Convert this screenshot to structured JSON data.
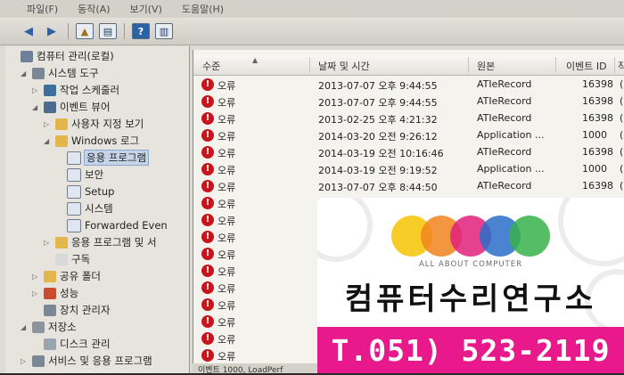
{
  "menu": [
    "파일(F)",
    "동작(A)",
    "보기(V)",
    "도움말(H)"
  ],
  "tree": {
    "items": [
      {
        "label": "컴퓨터 관리(로컬)",
        "icon": "computer-management-icon",
        "level": 0,
        "arrow": ""
      },
      {
        "label": "시스템 도구",
        "icon": "tools-icon",
        "level": 1,
        "arrow": "◢"
      },
      {
        "label": "작업 스케줄러",
        "icon": "clock-icon",
        "level": 2,
        "arrow": "▷"
      },
      {
        "label": "이벤트 뷰어",
        "icon": "event-viewer-icon",
        "level": 2,
        "arrow": "◢"
      },
      {
        "label": "사용자 지정 보기",
        "icon": "folder-icon",
        "level": 3,
        "arrow": "▷"
      },
      {
        "label": "Windows 로그",
        "icon": "folder-icon",
        "level": 3,
        "arrow": "◢"
      },
      {
        "label": "응용 프로그램",
        "icon": "log-icon",
        "level": 4,
        "arrow": "",
        "selected": true
      },
      {
        "label": "보안",
        "icon": "log-icon",
        "level": 4,
        "arrow": ""
      },
      {
        "label": "Setup",
        "icon": "log-icon",
        "level": 4,
        "arrow": ""
      },
      {
        "label": "시스템",
        "icon": "log-icon",
        "level": 4,
        "arrow": ""
      },
      {
        "label": "Forwarded Even",
        "icon": "log-icon",
        "level": 4,
        "arrow": ""
      },
      {
        "label": "응용 프로그램 및 서",
        "icon": "folder-icon",
        "level": 3,
        "arrow": "▷"
      },
      {
        "label": "구독",
        "icon": "subscription-icon",
        "level": 3,
        "arrow": ""
      },
      {
        "label": "공유 폴더",
        "icon": "shared-folder-icon",
        "level": 2,
        "arrow": "▷"
      },
      {
        "label": "성능",
        "icon": "performance-icon",
        "level": 2,
        "arrow": "▷"
      },
      {
        "label": "장치 관리자",
        "icon": "device-manager-icon",
        "level": 2,
        "arrow": ""
      },
      {
        "label": "저장소",
        "icon": "storage-icon",
        "level": 1,
        "arrow": "◢"
      },
      {
        "label": "디스크 관리",
        "icon": "disk-icon",
        "level": 2,
        "arrow": ""
      },
      {
        "label": "서비스 및 응용 프로그램",
        "icon": "services-icon",
        "level": 1,
        "arrow": "▷"
      }
    ]
  },
  "list": {
    "columns": [
      "수준",
      "날짜 및 시간",
      "원본",
      "이벤트 ID",
      "작"
    ],
    "rows": [
      {
        "level": "오류",
        "datetime": "2013-07-07 오후 9:44:55",
        "source": "ATIeRecord",
        "id": "16398",
        "task": "("
      },
      {
        "level": "오류",
        "datetime": "2013-07-07 오후 9:44:55",
        "source": "ATIeRecord",
        "id": "16398",
        "task": "("
      },
      {
        "level": "오류",
        "datetime": "2013-02-25 오후 4:21:32",
        "source": "ATIeRecord",
        "id": "16398",
        "task": "("
      },
      {
        "level": "오류",
        "datetime": "2014-03-20 오전 9:26:12",
        "source": "Application ...",
        "id": "1000",
        "task": "("
      },
      {
        "level": "오류",
        "datetime": "2014-03-19 오전 10:16:46",
        "source": "ATIeRecord",
        "id": "16398",
        "task": "("
      },
      {
        "level": "오류",
        "datetime": "2014-03-19 오전 9:19:52",
        "source": "Application ...",
        "id": "1000",
        "task": "("
      },
      {
        "level": "오류",
        "datetime": "2013-07-07 오후 8:44:50",
        "source": "ATIeRecord",
        "id": "16398",
        "task": "("
      },
      {
        "level": "오류",
        "datetime": "",
        "source": "",
        "id": "",
        "task": ""
      },
      {
        "level": "오류",
        "datetime": "",
        "source": "",
        "id": "",
        "task": ""
      },
      {
        "level": "오류",
        "datetime": "",
        "source": "",
        "id": "",
        "task": ""
      },
      {
        "level": "오류",
        "datetime": "",
        "source": "",
        "id": "",
        "task": ""
      },
      {
        "level": "오류",
        "datetime": "",
        "source": "",
        "id": "",
        "task": ""
      },
      {
        "level": "오류",
        "datetime": "",
        "source": "",
        "id": "",
        "task": ""
      },
      {
        "level": "오류",
        "datetime": "",
        "source": "",
        "id": "",
        "task": ""
      },
      {
        "level": "오류",
        "datetime": "",
        "source": "",
        "id": "",
        "task": ""
      },
      {
        "level": "오류",
        "datetime": "",
        "source": "",
        "id": "",
        "task": ""
      },
      {
        "level": "오류",
        "datetime": "",
        "source": "",
        "id": "",
        "task": ""
      }
    ]
  },
  "status_text": "이벤트 1000, LoadPerf",
  "ad": {
    "tagline": "ALL ABOUT COMPUTER",
    "title": "컴퓨터수리연구소",
    "phone": "T.051) 523-2119",
    "circle_colors": [
      "#f5c400",
      "#f0841f",
      "#e0207a",
      "#2a6fc9",
      "#37b24a"
    ],
    "phone_bar_color": "#e8198b"
  }
}
